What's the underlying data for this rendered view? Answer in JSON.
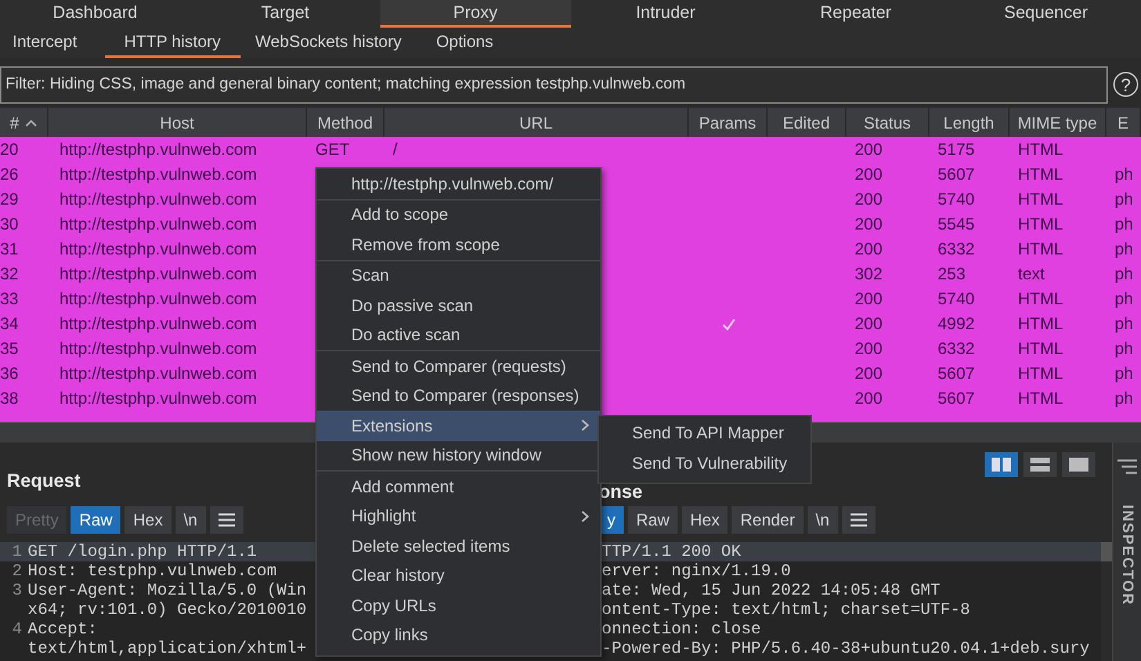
{
  "main_tabs": [
    {
      "label": "Dashboard",
      "selected": false
    },
    {
      "label": "Target",
      "selected": false
    },
    {
      "label": "Proxy",
      "selected": true
    },
    {
      "label": "Intruder",
      "selected": false
    },
    {
      "label": "Repeater",
      "selected": false
    },
    {
      "label": "Sequencer",
      "selected": false
    }
  ],
  "sub_tabs": [
    {
      "label": "Intercept",
      "selected": false
    },
    {
      "label": "HTTP history",
      "selected": true
    },
    {
      "label": "WebSockets history",
      "selected": false
    },
    {
      "label": "Options",
      "selected": false
    }
  ],
  "filter": {
    "text": "Filter: Hiding CSS, image and general binary content;  matching expression testphp.vulnweb.com",
    "help": "?"
  },
  "table": {
    "columns": [
      "#",
      "Host",
      "Method",
      "URL",
      "Params",
      "Edited",
      "Status",
      "Length",
      "MIME type",
      "E"
    ],
    "rows": [
      {
        "num": "20",
        "host": "http://testphp.vulnweb.com",
        "method": "GET",
        "url": "/",
        "params": false,
        "status": "200",
        "length": "5175",
        "mime": "HTML",
        "color": "#e040e0"
      },
      {
        "num": "26",
        "host": "http://testphp.vulnweb.com",
        "params": false,
        "status": "200",
        "length": "5607",
        "mime": "HTML",
        "ext": "ph",
        "color": "#e040e0"
      },
      {
        "num": "29",
        "host": "http://testphp.vulnweb.com",
        "params": false,
        "status": "200",
        "length": "5740",
        "mime": "HTML",
        "ext": "ph",
        "color": "#e040e0"
      },
      {
        "num": "30",
        "host": "http://testphp.vulnweb.com",
        "params": false,
        "status": "200",
        "length": "5545",
        "mime": "HTML",
        "ext": "ph",
        "color": "#e040e0"
      },
      {
        "num": "31",
        "host": "http://testphp.vulnweb.com",
        "params": false,
        "status": "200",
        "length": "6332",
        "mime": "HTML",
        "ext": "ph",
        "color": "#e040e0"
      },
      {
        "num": "32",
        "host": "http://testphp.vulnweb.com",
        "params": false,
        "status": "302",
        "length": "253",
        "mime": "text",
        "ext": "ph",
        "color": "#e040e0"
      },
      {
        "num": "33",
        "host": "http://testphp.vulnweb.com",
        "params": false,
        "status": "200",
        "length": "5740",
        "mime": "HTML",
        "ext": "ph",
        "color": "#e040e0"
      },
      {
        "num": "34",
        "host": "http://testphp.vulnweb.com",
        "params": true,
        "status": "200",
        "length": "4992",
        "mime": "HTML",
        "ext": "ph",
        "color": "#e040e0"
      },
      {
        "num": "35",
        "host": "http://testphp.vulnweb.com",
        "params": false,
        "status": "200",
        "length": "6332",
        "mime": "HTML",
        "ext": "ph",
        "color": "#e040e0"
      },
      {
        "num": "36",
        "host": "http://testphp.vulnweb.com",
        "params": false,
        "status": "200",
        "length": "5607",
        "mime": "HTML",
        "ext": "ph",
        "color": "#e040e0"
      },
      {
        "num": "38",
        "host": "http://testphp.vulnweb.com",
        "params": false,
        "status": "200",
        "length": "5607",
        "mime": "HTML",
        "ext": "ph",
        "color": "#e040e0"
      }
    ]
  },
  "request": {
    "title": "Request",
    "buttons": [
      {
        "kind": "text",
        "label": "Pretty",
        "selected": false,
        "disabled": true
      },
      {
        "kind": "text",
        "label": "Raw",
        "selected": true,
        "disabled": false
      },
      {
        "kind": "text",
        "label": "Hex",
        "selected": false,
        "disabled": false
      },
      {
        "kind": "text",
        "label": "\\n",
        "selected": false,
        "disabled": false
      },
      {
        "kind": "menu",
        "selected": false,
        "disabled": false
      }
    ],
    "lines": [
      {
        "number": "1",
        "text": "GET /login.php HTTP/1.1"
      },
      {
        "number": "2",
        "text": "Host: testphp.vulnweb.com"
      },
      {
        "number": "3",
        "text": "User-Agent: Mozilla/5.0 (Win"
      },
      {
        "text": "x64; rv:101.0) Gecko/2010010"
      },
      {
        "number": "4",
        "text": "Accept:"
      },
      {
        "text": "text/html,application/xhtml+"
      }
    ]
  },
  "response": {
    "title": "onse",
    "layouts": [
      {
        "kind": "split",
        "selected": true
      },
      {
        "kind": "stacked",
        "selected": false
      },
      {
        "kind": "single",
        "selected": false
      }
    ],
    "buttons": [
      {
        "kind": "text",
        "label": "y",
        "selected": true
      },
      {
        "kind": "text",
        "label": "Raw",
        "selected": false
      },
      {
        "kind": "text",
        "label": "Hex",
        "selected": false
      },
      {
        "kind": "text",
        "label": "Render",
        "selected": false
      },
      {
        "kind": "text",
        "label": "\\n",
        "selected": false
      },
      {
        "kind": "menu",
        "selected": false
      }
    ],
    "lines": [
      {
        "text": "TTP/1.1 200 OK"
      },
      {
        "text": "erver: nginx/1.19.0"
      },
      {
        "text": "ate: Wed, 15 Jun 2022 14:05:48 GMT"
      },
      {
        "text": "ontent-Type: text/html; charset=UTF-8"
      },
      {
        "text": "onnection: close"
      },
      {
        "text": "-Powered-By: PHP/5.6.40-38+ubuntu20.04.1+deb.sury"
      }
    ]
  },
  "inspector": {
    "label": "INSPECTOR"
  },
  "context_menu": {
    "items": [
      {
        "kind": "header",
        "label": "http://testphp.vulnweb.com/",
        "selected": false,
        "submenu": false
      },
      {
        "kind": "separator"
      },
      {
        "kind": "item",
        "label": "Add to scope",
        "selected": false,
        "submenu": false
      },
      {
        "kind": "item",
        "label": "Remove from scope",
        "selected": false,
        "submenu": false
      },
      {
        "kind": "separator"
      },
      {
        "kind": "item",
        "label": "Scan",
        "selected": false,
        "submenu": false
      },
      {
        "kind": "item",
        "label": "Do passive scan",
        "selected": false,
        "submenu": false
      },
      {
        "kind": "item",
        "label": "Do active scan",
        "selected": false,
        "submenu": false
      },
      {
        "kind": "separator"
      },
      {
        "kind": "item",
        "label": "Send to Comparer (requests)",
        "selected": false,
        "submenu": false
      },
      {
        "kind": "item",
        "label": "Send to Comparer (responses)",
        "selected": false,
        "submenu": false
      },
      {
        "kind": "item",
        "label": "Extensions",
        "selected": true,
        "submenu": true
      },
      {
        "kind": "item",
        "label": "Show new history window",
        "selected": false,
        "submenu": false
      },
      {
        "kind": "separator"
      },
      {
        "kind": "item",
        "label": "Add comment",
        "selected": false,
        "submenu": false
      },
      {
        "kind": "item",
        "label": "Highlight",
        "selected": false,
        "submenu": true
      },
      {
        "kind": "item",
        "label": "Delete selected items",
        "selected": false,
        "submenu": false
      },
      {
        "kind": "item",
        "label": "Clear history",
        "selected": false,
        "submenu": false
      },
      {
        "kind": "item",
        "label": "Copy URLs",
        "selected": false,
        "submenu": false
      },
      {
        "kind": "item",
        "label": "Copy links",
        "selected": false,
        "submenu": false
      }
    ]
  },
  "submenu": {
    "items": [
      {
        "label": "Send To API Mapper"
      },
      {
        "label": "Send To Vulnerability"
      }
    ]
  }
}
